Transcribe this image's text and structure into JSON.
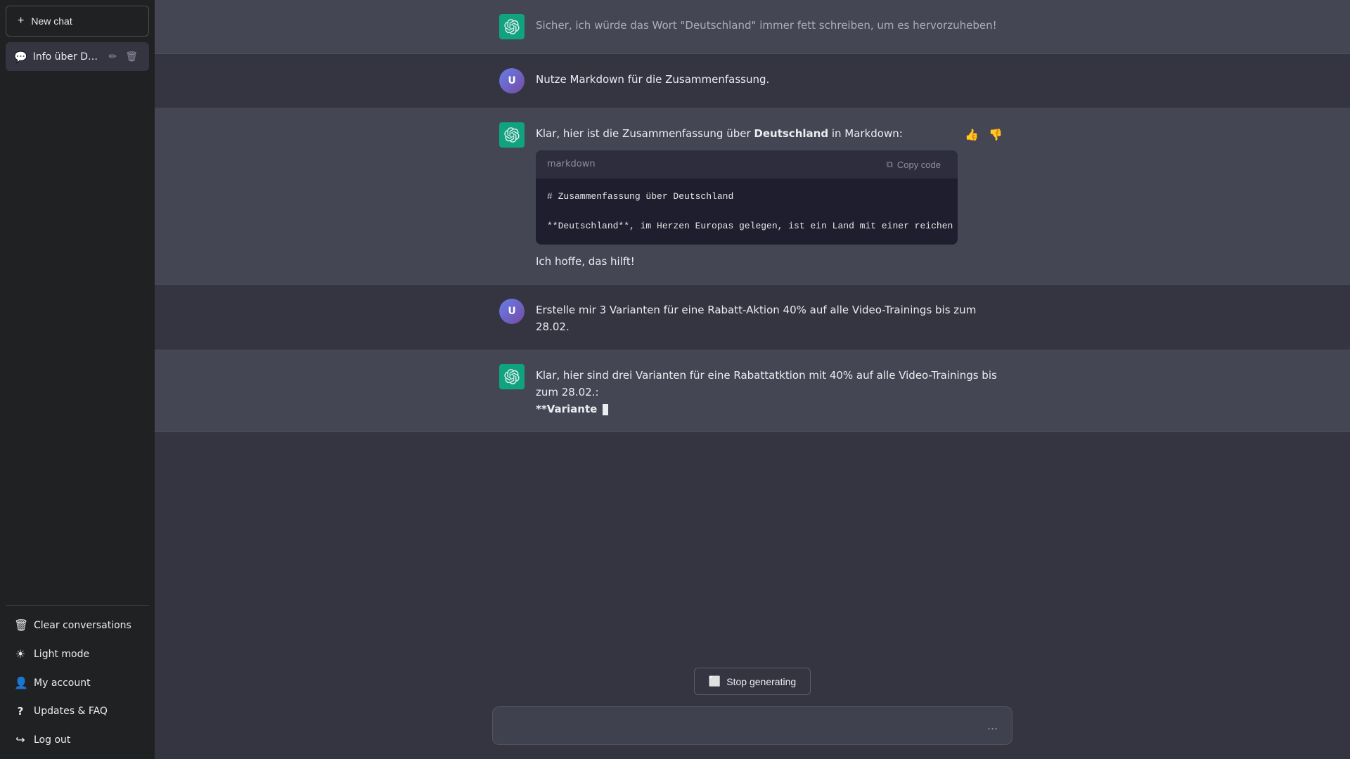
{
  "sidebar": {
    "new_chat_label": "New chat",
    "chat_items": [
      {
        "id": "info-deutschland",
        "label": "Info über Deutschland.",
        "active": true
      }
    ],
    "bottom_items": [
      {
        "id": "clear-conversations",
        "label": "Clear conversations",
        "icon": "🗑"
      },
      {
        "id": "light-mode",
        "label": "Light mode",
        "icon": "☀"
      },
      {
        "id": "my-account",
        "label": "My account",
        "icon": "👤"
      },
      {
        "id": "updates-faq",
        "label": "Updates & FAQ",
        "icon": "?"
      },
      {
        "id": "log-out",
        "label": "Log out",
        "icon": "→"
      }
    ]
  },
  "messages": [
    {
      "id": "msg1",
      "role": "assistant",
      "faded_text": "Sicher, ich würde das Wort \"Deutschland\" immer fett schreiben, um es hervorzuheben!"
    },
    {
      "id": "msg2",
      "role": "user",
      "text": "Nutze Markdown für die Zusammenfassung."
    },
    {
      "id": "msg3",
      "role": "assistant",
      "text_before": "Klar, hier ist die Zusammenfassung über ",
      "bold_word": "Deutschland",
      "text_after": " in Markdown:",
      "code_lang": "markdown",
      "code_copy_label": "Copy code",
      "code_line1": "# Zusammenfassung über Deutschland",
      "code_line2": "",
      "code_line3": "**Deutschland**, im Herzen Europas gelegen, ist ein Land mit einer reichen Kulturge",
      "text_end": "Ich hoffe, das hilft!"
    },
    {
      "id": "msg4",
      "role": "user",
      "text": "Erstelle mir 3 Varianten für eine Rabatt-Aktion 40% auf alle Video-Trainings bis zum 28.02."
    },
    {
      "id": "msg5",
      "role": "assistant",
      "text1": "Klar, hier sind drei Varianten für eine Rabattatktion mit 40% auf alle Video-Trainings bis zum 28.02.:",
      "text2_bold": "**Variante ",
      "cursor": true
    }
  ],
  "stop_generating": {
    "label": "Stop generating",
    "icon": "⬜"
  },
  "input": {
    "placeholder": ""
  },
  "send_icon": "➤",
  "ellipsis_icon": "..."
}
